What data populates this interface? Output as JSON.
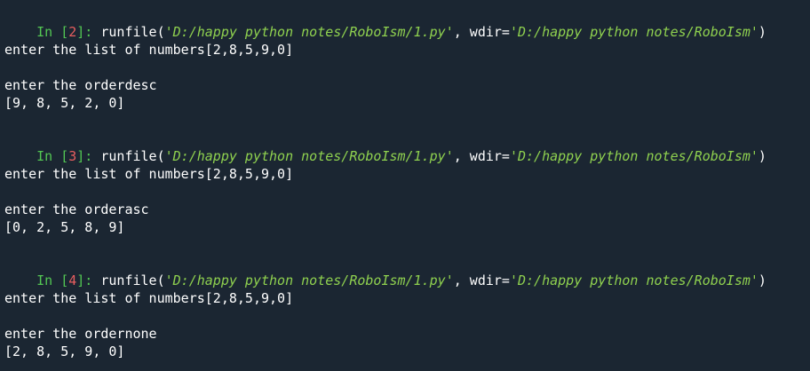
{
  "sessions": [
    {
      "prompt_in": "In [",
      "prompt_num": "2",
      "prompt_close": "]:",
      "func": "runfile(",
      "file_path": "'D:/happy python notes/RoboIsm/1.py'",
      "sep": ", wdir=",
      "wdir_path": "'D:/happy python notes/RoboIsm'",
      "close_paren": ")",
      "list_line": "enter the list of numbers[2,8,5,9,0]",
      "order_line": "enter the orderdesc",
      "result": "[9, 8, 5, 2, 0]"
    },
    {
      "prompt_in": "In [",
      "prompt_num": "3",
      "prompt_close": "]:",
      "func": "runfile(",
      "file_path": "'D:/happy python notes/RoboIsm/1.py'",
      "sep": ", wdir=",
      "wdir_path": "'D:/happy python notes/RoboIsm'",
      "close_paren": ")",
      "list_line": "enter the list of numbers[2,8,5,9,0]",
      "order_line": "enter the orderasc",
      "result": "[0, 2, 5, 8, 9]"
    },
    {
      "prompt_in": "In [",
      "prompt_num": "4",
      "prompt_close": "]:",
      "func": "runfile(",
      "file_path": "'D:/happy python notes/RoboIsm/1.py'",
      "sep": ", wdir=",
      "wdir_path": "'D:/happy python notes/RoboIsm'",
      "close_paren": ")",
      "list_line": "enter the list of numbers[2,8,5,9,0]",
      "order_line": "enter the ordernone",
      "result": "[2, 8, 5, 9, 0]"
    }
  ],
  "colors": {
    "background": "#1b2632",
    "prompt_green": "#53c653",
    "prompt_number_red": "#e85f5f",
    "string_green": "#8fd14f",
    "text_white": "#ffffff"
  }
}
